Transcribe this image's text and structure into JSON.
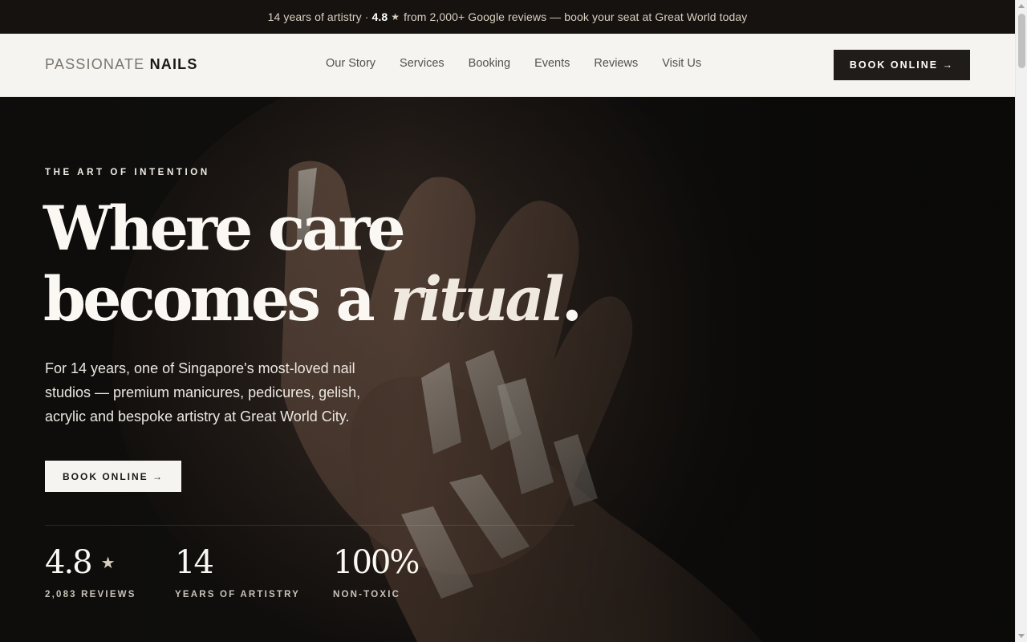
{
  "announcement": {
    "lead": "14 years of artistry ·",
    "rating": "4.8",
    "star_icon": "★",
    "tail": "from 2,000+ Google reviews — book your seat at Great World today"
  },
  "header": {
    "logo_light": "PASSIONATE",
    "logo_strong": "NAILS",
    "nav": [
      "Our Story",
      "Services",
      "Booking",
      "Events",
      "Reviews",
      "Visit Us"
    ],
    "cta": "BOOK ONLINE →"
  },
  "hero": {
    "eyebrow": "THE ART OF INTENTION",
    "headline_line1": "Where care",
    "headline_line2_start": "becomes a ",
    "headline_accent": "ritual",
    "headline_end": ".",
    "intro": "For 14 years, one of Singapore's most-loved nail studios — premium manicures, pedicures, gelish, acrylic and bespoke artistry at Great World City.",
    "cta": "BOOK ONLINE →",
    "stats": [
      {
        "value": "4.8",
        "icon": "★",
        "label": "2,083 REVIEWS"
      },
      {
        "value": "14",
        "label": "YEARS OF ARTISTRY"
      },
      {
        "value": "100%",
        "label": "NON-TOXIC"
      }
    ]
  },
  "colors": {
    "announce_bg": "#15120f",
    "header_bg": "#f6f4f1",
    "dark_button": "#1f1c19",
    "hero_bg": "#0d0c0b"
  }
}
